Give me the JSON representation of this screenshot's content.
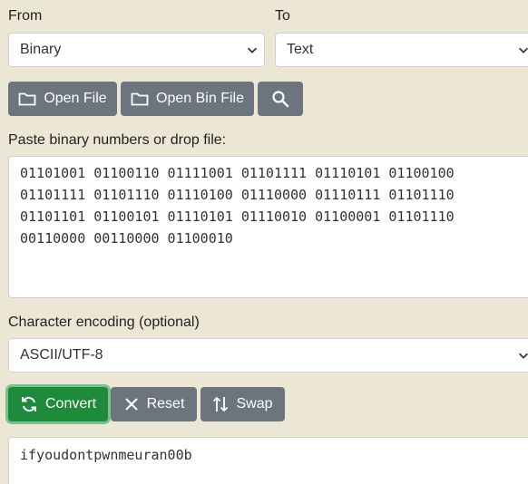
{
  "from": {
    "label": "From",
    "value": "Binary"
  },
  "to": {
    "label": "To",
    "value": "Text"
  },
  "toolbar": {
    "open_file": "Open File",
    "open_bin_file": "Open Bin File"
  },
  "input": {
    "label": "Paste binary numbers or drop file:",
    "lines": [
      "01101001 01100110 01111001 01101111 01110101 01100100",
      "01101111 01101110 01110100 01110000 01110111 01101110",
      "01101101 01100101 01110101 01110010 01100001 01101110",
      "00110000 00110000 01100010"
    ]
  },
  "encoding": {
    "label": "Character encoding (optional)",
    "value": "ASCII/UTF-8"
  },
  "actions": {
    "convert": "Convert",
    "reset": "Reset",
    "swap": "Swap"
  },
  "output": {
    "value": "ifyoudontpwnmeuran00b"
  },
  "colors": {
    "background": "#ece6d5",
    "gray_button": "#6c757d",
    "convert_button": "#1e8a3c"
  },
  "icons": [
    "chevron-down-icon",
    "folder-icon",
    "search-icon",
    "refresh-icon",
    "close-icon",
    "swap-icon"
  ]
}
